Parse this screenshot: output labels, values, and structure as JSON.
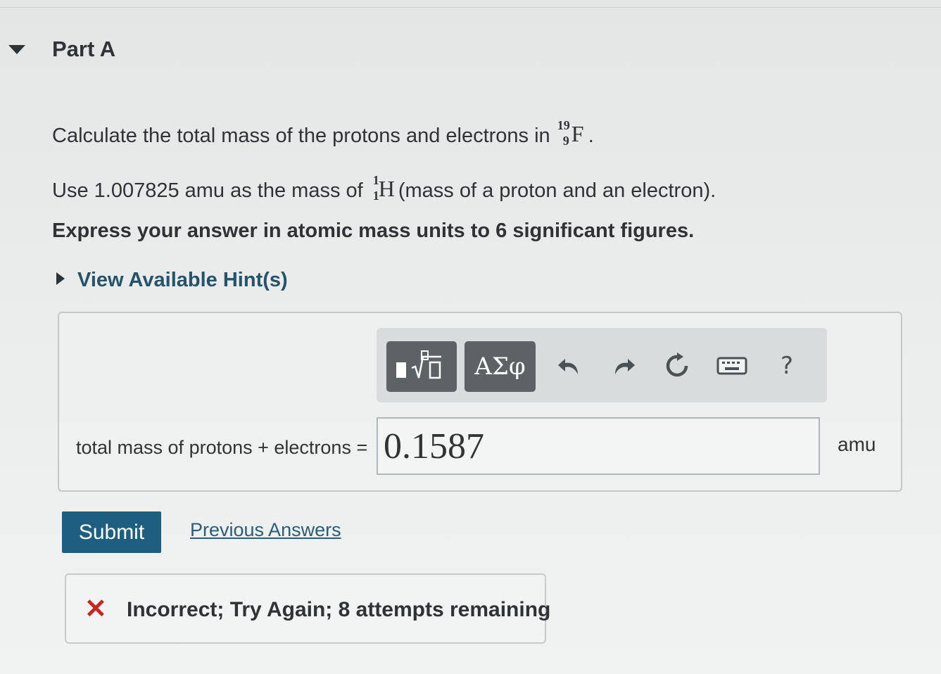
{
  "part": {
    "title": "Part A",
    "question": {
      "line1_prefix": "Calculate the total mass of the protons and electrons in ",
      "nuclide_f": {
        "mass_number": "19",
        "atomic_number": "9",
        "symbol": "F"
      },
      "line1_suffix": ".",
      "line2_prefix": "Use 1.007825 amu as the mass of ",
      "nuclide_h": {
        "mass_number": "1",
        "atomic_number": "1",
        "symbol": "H"
      },
      "line2_suffix": " (mass of a proton and an electron).",
      "instruction": "Express your answer in atomic mass units to 6 significant figures."
    },
    "hints_label": "View Available Hint(s)"
  },
  "toolbar": {
    "greek_label": "ΑΣφ",
    "help_label": "?",
    "icons": [
      "templates-icon",
      "greek-letters",
      "undo-icon",
      "redo-icon",
      "reset-icon",
      "keyboard-icon",
      "help-icon"
    ]
  },
  "answer": {
    "label": "total mass of protons + electrons =",
    "value": "0.1587",
    "unit": "amu"
  },
  "actions": {
    "submit_label": "Submit",
    "previous_answers_label": "Previous Answers"
  },
  "feedback": {
    "status": "incorrect",
    "message": "Incorrect; Try Again; 8 attempts remaining",
    "color": "#c8261e"
  }
}
